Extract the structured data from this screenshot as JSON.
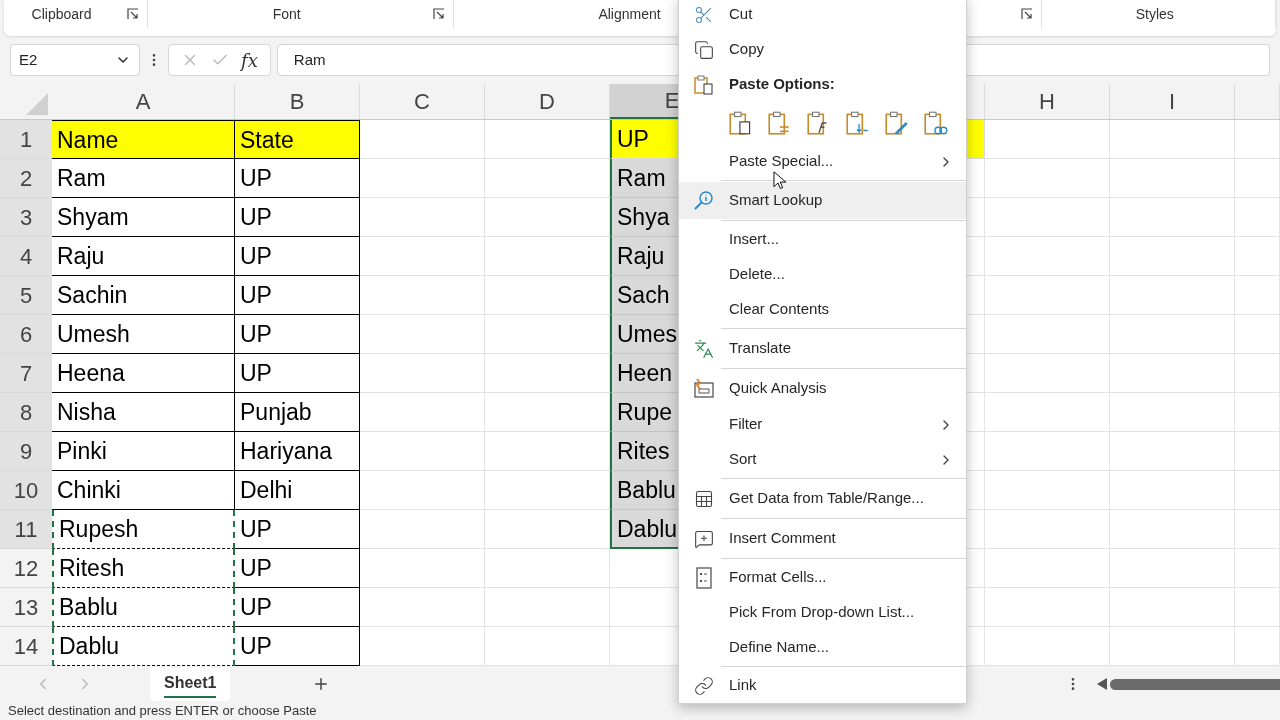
{
  "ribbon_groups": [
    {
      "label": "Clipboard",
      "launcher": true
    },
    {
      "label": "Font",
      "launcher": true
    },
    {
      "label": "Alignment",
      "launcher": false
    },
    {
      "launcher": true
    },
    {
      "label": "Styles",
      "launcher": false
    }
  ],
  "formula_bar": {
    "name_box": "E2",
    "function_button": "fx",
    "formula": "Ram"
  },
  "columns": [
    {
      "label": "A",
      "selected": false
    },
    {
      "label": "B",
      "selected": false
    },
    {
      "label": "C",
      "selected": false
    },
    {
      "label": "D",
      "selected": false
    },
    {
      "label": "E",
      "selected": true
    },
    {
      "label": "H",
      "selected": false
    },
    {
      "label": "I",
      "selected": false
    },
    {
      "selected": false
    }
  ],
  "rows": [
    {
      "number": "1",
      "A": "Name",
      "B": "State",
      "E": "UP",
      "highlighted": true,
      "copied": false,
      "selected": true
    },
    {
      "number": "2",
      "A": "Ram",
      "B": "UP",
      "E": "Ram",
      "highlighted": false,
      "copied": false,
      "selected": true
    },
    {
      "number": "3",
      "A": "Shyam",
      "B": "UP",
      "E": "Shya",
      "highlighted": false,
      "copied": false,
      "selected": true
    },
    {
      "number": "4",
      "A": "Raju",
      "B": "UP",
      "E": "Raju",
      "highlighted": false,
      "copied": false,
      "selected": true
    },
    {
      "number": "5",
      "A": "Sachin",
      "B": "UP",
      "E": "Sach",
      "highlighted": false,
      "copied": false,
      "selected": true
    },
    {
      "number": "6",
      "A": "Umesh",
      "B": "UP",
      "E": "Umes",
      "highlighted": false,
      "copied": false,
      "selected": true
    },
    {
      "number": "7",
      "A": "Heena",
      "B": "UP",
      "E": "Heen",
      "highlighted": false,
      "copied": false,
      "selected": true
    },
    {
      "number": "8",
      "A": "Nisha",
      "B": "Punjab",
      "E": "Rupe",
      "highlighted": false,
      "copied": false,
      "selected": true
    },
    {
      "number": "9",
      "A": "Pinki",
      "B": "Hariyana",
      "E": "Rites",
      "highlighted": false,
      "copied": false,
      "selected": true
    },
    {
      "number": "10",
      "A": "Chinki",
      "B": "Delhi",
      "E": "Bablu",
      "highlighted": false,
      "copied": false,
      "selected": true
    },
    {
      "number": "11",
      "A": "Rupesh",
      "B": "UP",
      "E": "Dablu",
      "highlighted": false,
      "copied": true,
      "selected": true
    },
    {
      "number": "12",
      "A": "Ritesh",
      "B": "UP",
      "highlighted": false,
      "copied": true,
      "selected": false
    },
    {
      "number": "13",
      "A": "Bablu",
      "B": "UP",
      "highlighted": false,
      "copied": true,
      "selected": false
    },
    {
      "number": "14",
      "A": "Dablu",
      "B": "UP",
      "highlighted": false,
      "copied": true,
      "selected": false
    }
  ],
  "context_menu": [
    {
      "kind": "item",
      "label": "Cut",
      "submenu": false,
      "highlighted": false
    },
    {
      "kind": "item",
      "label": "Copy",
      "submenu": false,
      "highlighted": false
    },
    {
      "kind": "header",
      "label": "Paste Options:"
    },
    {
      "kind": "paste-icons"
    },
    {
      "kind": "item",
      "label": "Paste Special...",
      "submenu": true,
      "highlighted": false
    },
    {
      "kind": "separator"
    },
    {
      "kind": "item",
      "label": "Smart Lookup",
      "submenu": false,
      "highlighted": true
    },
    {
      "kind": "separator"
    },
    {
      "kind": "item",
      "label": "Insert...",
      "submenu": false,
      "highlighted": false
    },
    {
      "kind": "item",
      "label": "Delete...",
      "submenu": false,
      "highlighted": false
    },
    {
      "kind": "item",
      "label": "Clear Contents",
      "submenu": false,
      "highlighted": false
    },
    {
      "kind": "separator"
    },
    {
      "kind": "item",
      "label": "Translate",
      "submenu": false,
      "highlighted": false
    },
    {
      "kind": "separator"
    },
    {
      "kind": "item",
      "label": "Quick Analysis",
      "submenu": false,
      "highlighted": false
    },
    {
      "kind": "item",
      "label": "Filter",
      "submenu": true,
      "highlighted": false
    },
    {
      "kind": "item",
      "label": "Sort",
      "submenu": true,
      "highlighted": false
    },
    {
      "kind": "separator"
    },
    {
      "kind": "item",
      "label": "Get Data from Table/Range...",
      "submenu": false,
      "highlighted": false
    },
    {
      "kind": "separator"
    },
    {
      "kind": "item",
      "label": "Insert Comment",
      "submenu": false,
      "highlighted": false
    },
    {
      "kind": "separator"
    },
    {
      "kind": "item",
      "label": "Format Cells...",
      "submenu": false,
      "highlighted": false
    },
    {
      "kind": "item",
      "label": "Pick From Drop-down List...",
      "submenu": false,
      "highlighted": false
    },
    {
      "kind": "item",
      "label": "Define Name...",
      "submenu": false,
      "highlighted": false
    },
    {
      "kind": "separator"
    },
    {
      "kind": "item",
      "label": "Link",
      "submenu": false,
      "highlighted": false
    }
  ],
  "sheet_tabs": [
    {
      "label": "Sheet1",
      "selected": true
    }
  ],
  "status_bar": "Select destination and press ENTER or choose Paste"
}
